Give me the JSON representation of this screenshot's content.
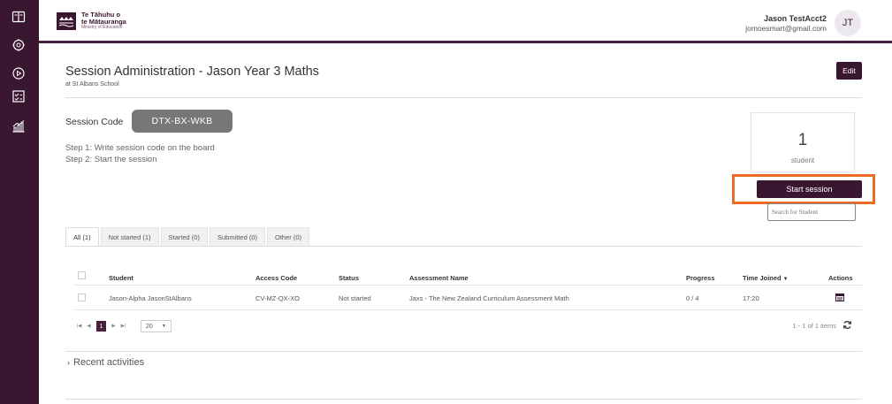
{
  "sidebar": {
    "icons": [
      "book-icon",
      "brain-icon",
      "play-circle-icon",
      "checklist-icon",
      "chart-icon"
    ]
  },
  "header": {
    "logo_line1": "Te Tāhuhu o",
    "logo_line2": "te Mātauranga",
    "logo_line3": "Ministry of Education",
    "user_name": "Jason TestAcct2",
    "user_email": "jomoesmart@gmail.com",
    "avatar_initials": "JT"
  },
  "page": {
    "title": "Session Administration - Jason Year 3 Maths",
    "subtitle": "at St Albans School",
    "edit_label": "Edit"
  },
  "session": {
    "code_label": "Session Code",
    "code_value": "DTX-BX-WKB",
    "step1": "Step 1: Write session code on the board",
    "step2": "Step 2: Start the session"
  },
  "summary": {
    "count": "1",
    "count_label": "student",
    "start_label": "Start session",
    "search_placeholder": "Search for Student"
  },
  "tabs": [
    {
      "label": "All (1)"
    },
    {
      "label": "Not started (1)"
    },
    {
      "label": "Started (0)"
    },
    {
      "label": "Submitted (0)"
    },
    {
      "label": "Other (0)"
    }
  ],
  "table": {
    "headers": {
      "student": "Student",
      "access_code": "Access Code",
      "status": "Status",
      "assessment": "Assessment Name",
      "progress": "Progress",
      "time_joined": "Time Joined",
      "actions": "Actions"
    },
    "rows": [
      {
        "student": "Jason-Alpha JasonStAlbans",
        "access_code": "CV-MZ-QX-XO",
        "status": "Not started",
        "assessment": "Jaxs - The New Zealand Curriculum Assessment Math",
        "progress": "0 / 4",
        "time_joined": "17:20"
      }
    ]
  },
  "pager": {
    "current_page": "1",
    "page_size": "20",
    "items_info": "1 - 1 of 1 items"
  },
  "recent": {
    "label": "Recent activities"
  },
  "colors": {
    "brand": "#3a1730",
    "highlight": "#ef6a22"
  }
}
